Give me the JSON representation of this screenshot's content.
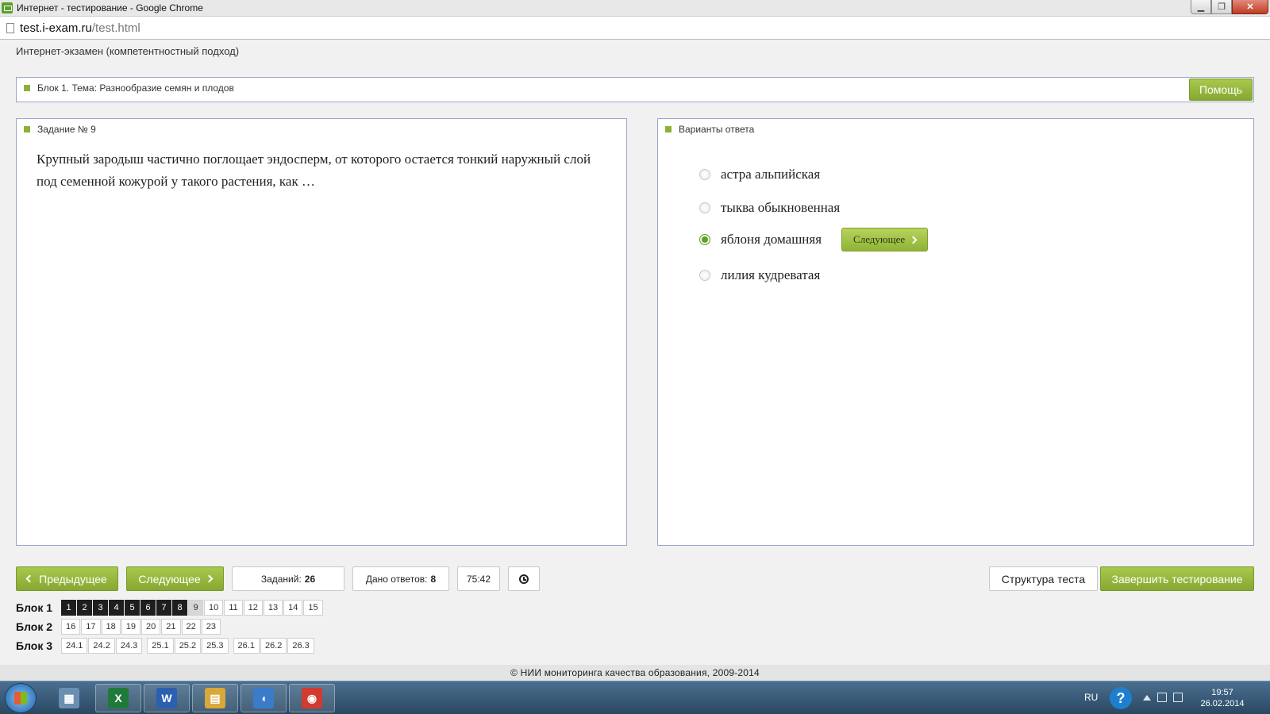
{
  "window": {
    "title": "Интернет - тестирование - Google Chrome",
    "minimize": "▁",
    "maximize": "❐",
    "close": "✕"
  },
  "address": {
    "host": "test.i-exam.ru",
    "path": "/test.html"
  },
  "app": {
    "header": "Интернет-экзамен (компетентностный подход)"
  },
  "block": {
    "title": "Блок 1. Тема: Разнообразие семян и плодов",
    "help_label": "Помощь"
  },
  "question": {
    "title": "Задание № 9",
    "text": "Крупный зародыш частично поглощает эндосперм, от которого остается тонкий наружный слой под семенной кожурой у такого растения, как …"
  },
  "answers": {
    "title": "Варианты ответа",
    "options": [
      {
        "label": "астра альпийская",
        "selected": false
      },
      {
        "label": "тыква обыкновенная",
        "selected": false
      },
      {
        "label": "яблоня домашняя",
        "selected": true
      },
      {
        "label": "лилия кудреватая",
        "selected": false
      }
    ],
    "next_label": "Следующее"
  },
  "nav": {
    "prev_label": "Предыдущее",
    "next_label": "Следующее",
    "tasks_label": "Заданий:",
    "tasks_count": "26",
    "answered_label": "Дано ответов:",
    "answered_count": "8",
    "timer": "75:42",
    "structure_label": "Структура теста",
    "finish_label": "Завершить тестирование"
  },
  "blocks": [
    {
      "label": "Блок 1",
      "groups": [
        [
          "1",
          "2",
          "3",
          "4",
          "5",
          "6",
          "7",
          "8",
          "9",
          "10",
          "11",
          "12",
          "13",
          "14",
          "15"
        ]
      ]
    },
    {
      "label": "Блок 2",
      "groups": [
        [
          "16",
          "17",
          "18",
          "19",
          "20",
          "21",
          "22",
          "23"
        ]
      ]
    },
    {
      "label": "Блок 3",
      "groups": [
        [
          "24.1",
          "24.2",
          "24.3"
        ],
        [
          "25.1",
          "25.2",
          "25.3"
        ],
        [
          "26.1",
          "26.2",
          "26.3"
        ]
      ]
    }
  ],
  "answered_tasks": [
    "1",
    "2",
    "3",
    "4",
    "5",
    "6",
    "7",
    "8"
  ],
  "current_task": "9",
  "footer": "© НИИ мониторинга качества образования, 2009-2014",
  "taskbar": {
    "lang": "RU",
    "help": "?",
    "time": "19:57",
    "date": "26.02.2014",
    "apps": [
      {
        "name": "calculator-icon",
        "glyph": "▦",
        "color": "#6b8fb0"
      },
      {
        "name": "excel-icon",
        "glyph": "X",
        "color": "#1f7a3a"
      },
      {
        "name": "word-icon",
        "glyph": "W",
        "color": "#2b5fb0"
      },
      {
        "name": "explorer-icon",
        "glyph": "▤",
        "color": "#d8a83a"
      },
      {
        "name": "speaker-icon",
        "glyph": "◖",
        "color": "#3a7cc9"
      },
      {
        "name": "chrome-icon",
        "glyph": "◉",
        "color": "#d23b2f"
      }
    ]
  }
}
